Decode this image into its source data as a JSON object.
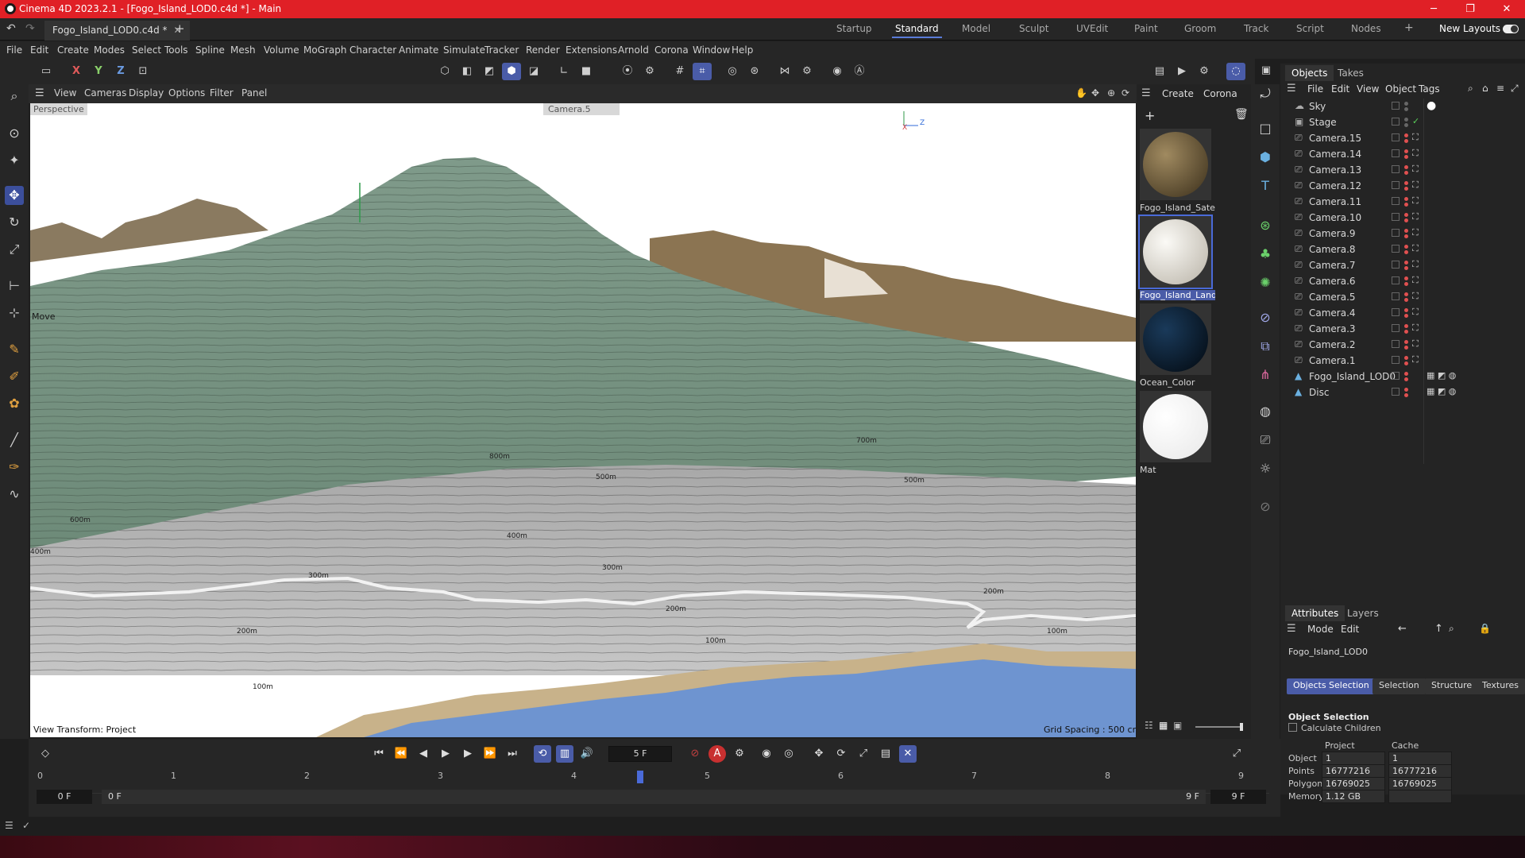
{
  "window": {
    "title": "Cinema 4D 2023.2.1 - [Fogo_Island_LOD0.c4d *] - Main",
    "minimize": "─",
    "maximize": "❐",
    "close": "✕"
  },
  "tabs": {
    "document": "Fogo_Island_LOD0.c4d *",
    "add": "+",
    "layouts": [
      "Startup",
      "Standard",
      "Model",
      "Sculpt",
      "UVEdit",
      "Paint",
      "Groom",
      "Track",
      "Script",
      "Nodes"
    ],
    "active_layout": "Standard",
    "new_layouts": "New Layouts"
  },
  "menu": [
    "File",
    "Edit",
    "Create",
    "Modes",
    "Select",
    "Tools",
    "Spline",
    "Mesh",
    "Volume",
    "MoGraph",
    "Character",
    "Animate",
    "Simulate",
    "Tracker",
    "Render",
    "Extensions",
    "Arnold",
    "Corona",
    "Window",
    "Help"
  ],
  "toolbar": {
    "x": "X",
    "y": "Y",
    "z": "Z"
  },
  "viewport": {
    "menu": [
      "View",
      "Cameras",
      "Display",
      "Options",
      "Filter",
      "Panel"
    ],
    "camera_label": "Perspective",
    "camera_select": "Camera.5",
    "tool_label": "Move",
    "view_transform": "View Transform: Project",
    "grid_spacing": "Grid Spacing : 500 cm",
    "axis_x": "X",
    "axis_z": "Z",
    "contours": [
      "800m",
      "700m",
      "600m",
      "500m",
      "500m",
      "400m",
      "400m",
      "300m",
      "300m",
      "200m",
      "200m",
      "200m",
      "100m",
      "100m",
      "100m"
    ]
  },
  "materials": {
    "menu": [
      "Create",
      "Corona"
    ],
    "items": [
      {
        "name": "Fogo_Island_Satel",
        "color": "#6b5a3a"
      },
      {
        "name": "Fogo_Island_Land",
        "color": "#e8e4dc"
      },
      {
        "name": "Ocean_Color",
        "color": "#0c1c2c"
      },
      {
        "name": "Mat",
        "color": "#ffffff"
      }
    ]
  },
  "objects": {
    "tabs": [
      "Objects",
      "Takes"
    ],
    "menu": [
      "File",
      "Edit",
      "View",
      "Object",
      "Tags"
    ],
    "items": [
      "Sky",
      "Stage",
      "Camera.15",
      "Camera.14",
      "Camera.13",
      "Camera.12",
      "Camera.11",
      "Camera.10",
      "Camera.9",
      "Camera.8",
      "Camera.7",
      "Camera.6",
      "Camera.5",
      "Camera.4",
      "Camera.3",
      "Camera.2",
      "Camera.1",
      "Fogo_Island_LOD0",
      "Disc"
    ]
  },
  "attributes": {
    "tabs": [
      "Attributes",
      "Layers"
    ],
    "menu": [
      "Mode",
      "Edit"
    ],
    "object_name": "Fogo_Island_LOD0",
    "subtabs": [
      "Objects Selection",
      "Selection",
      "Structure",
      "Textures"
    ],
    "section": "Object Selection",
    "calc_children": "Calculate Children",
    "col_project": "Project",
    "col_cache": "Cache",
    "rows": [
      {
        "label": "Object",
        "project": "1",
        "cache": "1"
      },
      {
        "label": "Points",
        "project": "16777216",
        "cache": "16777216"
      },
      {
        "label": "Polygons",
        "project": "16769025",
        "cache": "16769025"
      },
      {
        "label": "Memory",
        "project": "1.12 GB",
        "cache": ""
      }
    ]
  },
  "transport": {
    "current_frame": "5 F"
  },
  "timeline": {
    "ticks": [
      "0",
      "1",
      "2",
      "3",
      "4",
      "5",
      "6",
      "7",
      "8",
      "9"
    ],
    "start": "0 F",
    "range_start": "0 F",
    "range_end": "9 F",
    "end": "9 F",
    "current": 0.5
  }
}
